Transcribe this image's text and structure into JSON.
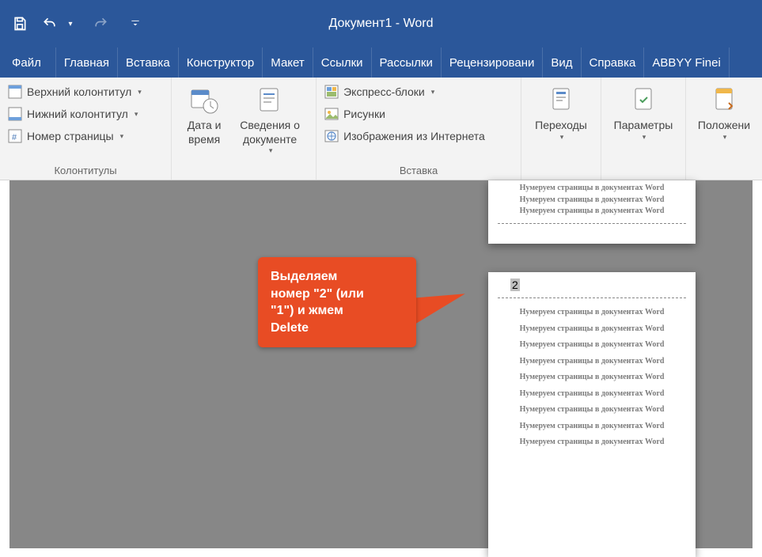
{
  "titlebar": {
    "title": "Документ1  -  Word"
  },
  "tabs": [
    "Файл",
    "Главная",
    "Вставка",
    "Конструктор",
    "Макет",
    "Ссылки",
    "Рассылки",
    "Рецензировани",
    "Вид",
    "Справка",
    "ABBYY Finei"
  ],
  "ribbon": {
    "group1": {
      "label": "Колонтитулы",
      "header": "Верхний колонтитул",
      "footer": "Нижний колонтитул",
      "pageNumber": "Номер страницы"
    },
    "group2": {
      "dateTime": "Дата и время",
      "docInfo": "Сведения о документе"
    },
    "group3": {
      "label": "Вставка",
      "quick": "Экспресс-блоки",
      "pictures": "Рисунки",
      "online": "Изображения из Интернета"
    },
    "group4": {
      "nav": "Переходы"
    },
    "group5": {
      "opts": "Параметры"
    },
    "group6": {
      "pos": "Положени"
    }
  },
  "callout": {
    "line1": "Выделяем",
    "line2": "номер \"2\" (или",
    "line3": "\"1\") и жмем",
    "line4": "Delete"
  },
  "doc": {
    "pageNumber2": "2",
    "repeatedText": "Нумеруем страницы в документах Word"
  },
  "colors": {
    "wordBlue": "#2b579a",
    "calloutOrange": "#e84c24",
    "docBg": "#878787"
  }
}
